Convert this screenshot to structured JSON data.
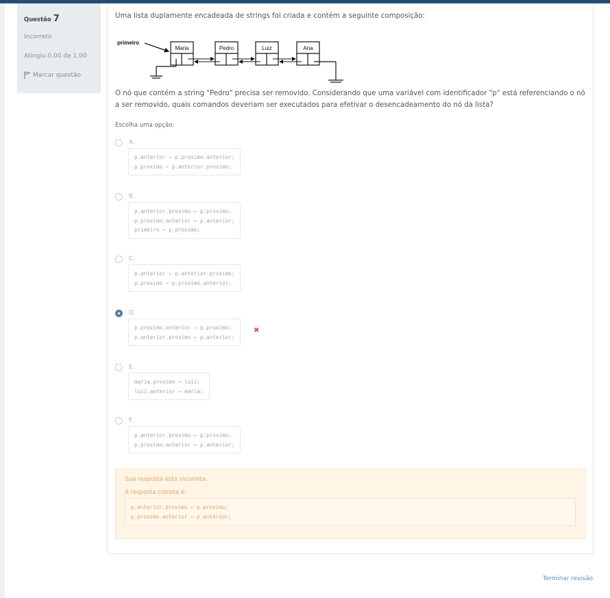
{
  "sidebar": {
    "question_label": "Questão",
    "question_number": "7",
    "state": "Incorreto",
    "grade": "Atingiu 0.00 de 1.00",
    "flag_label": "Marcar questão"
  },
  "question": {
    "intro": "Uma lista duplamente encadeada de strings foi criada e contém a seguinte composição:",
    "diagram": {
      "head_label": "primeiro",
      "nodes": [
        "Maria",
        "Pedro",
        "Luiz",
        "Ana"
      ]
    },
    "body": "O nó que contém a string \"Pedro\" precisa ser removido. Considerando que uma variável com identificador \"p\" está referenciando o nó a ser removido, quais comandos deveriam ser executados para efetivar o desencadeamento do nó da lista?",
    "prompt": "Escolha uma opção:"
  },
  "options": [
    {
      "letter": "A.",
      "code": "p.anterior ← p.proximo.anterior;\np.proximo ← p.anterior.proximo;",
      "selected": false
    },
    {
      "letter": "B.",
      "code": "p.anterior.proximo ← p.proximo;\np.proximo.anterior ← p.anterior;\nprimeiro ← p.proximo;",
      "selected": false
    },
    {
      "letter": "C.",
      "code": "p.anterior ← p.anterior.proximo;\np.proximo ← p.proximo.anterior;",
      "selected": false
    },
    {
      "letter": "D.",
      "code": "p.proximo.anterior ← p.proximo;\np.anterior.proximo ← p.anterior;",
      "selected": true
    },
    {
      "letter": "E.",
      "code": "maria.proximo ← luiz;\nluiz.anterior ← maria;",
      "selected": false
    },
    {
      "letter": "F.",
      "code": "p.anterior.proximo ← p.proximo;\np.proximo.anterior ← p.anterior;",
      "selected": false
    }
  ],
  "feedback": {
    "incorrect": "Sua resposta está incorreta.",
    "correct_intro": "A resposta correta é:",
    "correct_code": "p.anterior.proximo ← p.proximo;\np.proximo.anterior ← p.anterior;"
  },
  "footer": {
    "finish_review": "Terminar revisão"
  },
  "colors": {
    "topbar": "#234e74",
    "selected_radio": "#5b7fa3",
    "wrong": "#d9534f",
    "feedback_text": "#e9a15a",
    "link": "#5b8ab5"
  },
  "icons": {
    "flag": "flag-icon",
    "wrong": "cross-icon"
  }
}
